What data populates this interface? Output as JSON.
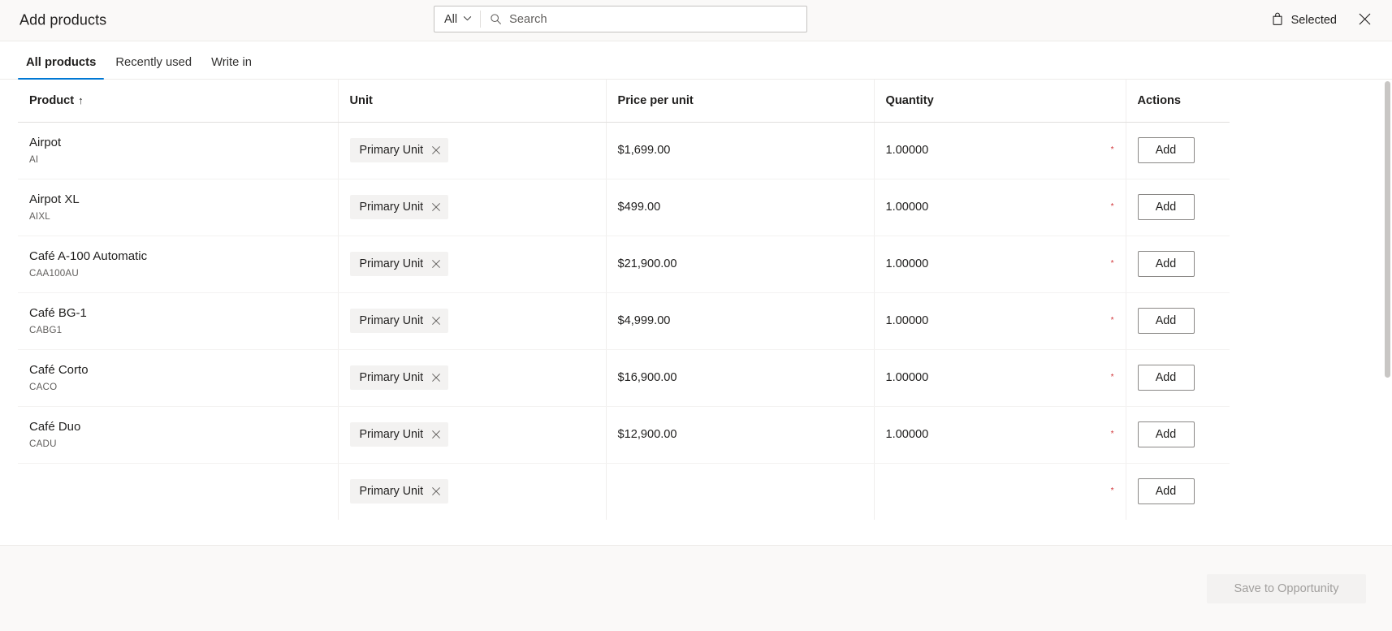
{
  "header": {
    "title": "Add products",
    "search": {
      "scope_label": "All",
      "scope_icon": "chevron-down-icon",
      "placeholder": "Search",
      "value": "",
      "icon": "search-icon"
    },
    "selected_button": {
      "label": "Selected",
      "icon": "shopping-bag-icon"
    },
    "close_button": {
      "icon": "close-icon"
    }
  },
  "tabs": [
    {
      "label": "All products",
      "active": true
    },
    {
      "label": "Recently used",
      "active": false
    },
    {
      "label": "Write in",
      "active": false
    }
  ],
  "table": {
    "columns": [
      {
        "label": "Product",
        "sort": "↑"
      },
      {
        "label": "Unit",
        "sort": ""
      },
      {
        "label": "Price per unit",
        "sort": ""
      },
      {
        "label": "Quantity",
        "sort": ""
      },
      {
        "label": "Actions",
        "sort": ""
      }
    ],
    "rows": [
      {
        "product": "Airpot",
        "code": "AI",
        "unit": "Primary Unit",
        "price": "$1,699.00",
        "quantity": "1.00000",
        "required": "*",
        "action": "Add"
      },
      {
        "product": "Airpot XL",
        "code": "AIXL",
        "unit": "Primary Unit",
        "price": "$499.00",
        "quantity": "1.00000",
        "required": "*",
        "action": "Add"
      },
      {
        "product": "Café A-100 Automatic",
        "code": "CAA100AU",
        "unit": "Primary Unit",
        "price": "$21,900.00",
        "quantity": "1.00000",
        "required": "*",
        "action": "Add"
      },
      {
        "product": "Café BG-1",
        "code": "CABG1",
        "unit": "Primary Unit",
        "price": "$4,999.00",
        "quantity": "1.00000",
        "required": "*",
        "action": "Add"
      },
      {
        "product": "Café Corto",
        "code": "CACO",
        "unit": "Primary Unit",
        "price": "$16,900.00",
        "quantity": "1.00000",
        "required": "*",
        "action": "Add"
      },
      {
        "product": "Café Duo",
        "code": "CADU",
        "unit": "Primary Unit",
        "price": "$12,900.00",
        "quantity": "1.00000",
        "required": "*",
        "action": "Add"
      },
      {
        "product": "",
        "code": "",
        "unit": "Primary Unit",
        "price": "",
        "quantity": "",
        "required": "*",
        "action": "Add"
      }
    ]
  },
  "footer": {
    "save_label": "Save to Opportunity"
  },
  "colors": {
    "accent": "#0078d4",
    "required": "#d13438",
    "header_bg": "#faf9f8",
    "chip_bg": "#f3f2f1"
  }
}
